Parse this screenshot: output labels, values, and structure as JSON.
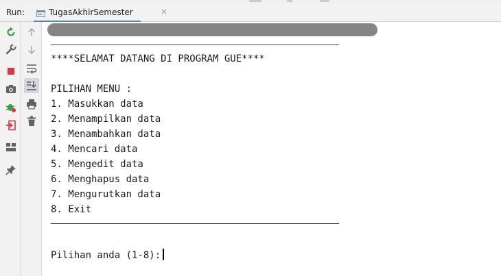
{
  "header": {
    "run_label": "Run:",
    "tab_label": "TugasAkhirSemester",
    "tab_close": "×",
    "accent_color": "#4a88c7"
  },
  "toolbar_left": {
    "icons": [
      "rerun-icon",
      "wrench-icon",
      "stop-icon",
      "camera-icon",
      "debug-icon",
      "exit-icon",
      "layout-icon",
      "pin-icon"
    ]
  },
  "toolbar_right": {
    "icons": [
      "arrow-up-icon",
      "arrow-down-icon",
      "soft-wrap-icon",
      "scroll-to-end-icon",
      "print-icon",
      "trash-icon"
    ]
  },
  "console": {
    "welcome": "****SELAMAT DATANG DI PROGRAM GUE****",
    "menu_title": "PILIHAN MENU :",
    "menu_items": [
      "1. Masukkan data",
      "2. Menampilkan data",
      "3. Menambahkan data",
      "4. Mencari data",
      "5. Mengedit data",
      "6. Menghapus data",
      "7. Mengurutkan data",
      "8. Exit"
    ],
    "prompt": "Pilihan anda (1-8):"
  }
}
